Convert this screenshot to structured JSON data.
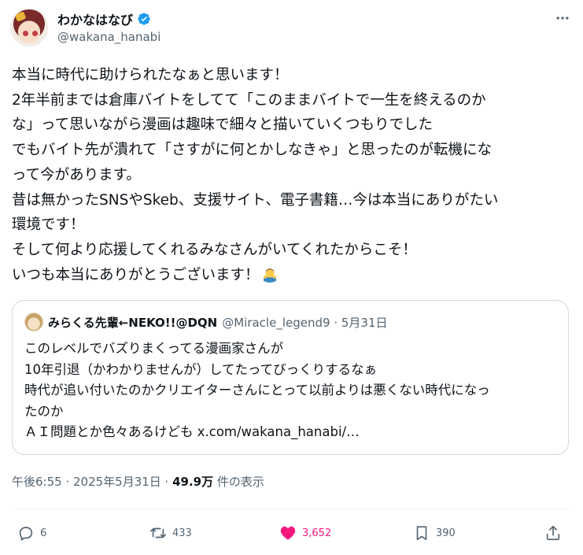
{
  "author": {
    "display_name": "わかなはなび",
    "handle": "@wakana_hanabi",
    "verified": true
  },
  "tweet": {
    "lines": [
      "本当に時代に助けられたなぁと思います！",
      "2年半前までは倉庫バイトをしてて「このままバイトで一生を終えるのか",
      "な」って思いながら漫画は趣味で細々と描いていくつもりでした",
      "でもバイト先が潰れて「さすがに何とかしなきゃ」と思ったのが転機にな",
      "って今があります。",
      "昔は無かったSNSやSkeb、支援サイト、電子書籍…今は本当にありがたい",
      "環境です！",
      "そして何より応援してくれるみなさんがいてくれたからこそ！",
      "いつも本当にありがとうございます！"
    ],
    "emoji_icon": "person-bowing-icon"
  },
  "quote": {
    "author_name": "みらくる先輩←NEKO!!@DQN",
    "handle_date": "@Miracle_legend9 · 5月31日",
    "lines": [
      "このレベルでバズりまくってる漫画家さんが",
      "10年引退（かわかりませんが）してたってびっくりするなぁ",
      "時代が追い付いたのかクリエイターさんにとって以前よりは悪くない時代になっ",
      "たのか",
      "ＡＩ問題とか色々あるけども x.com/wakana_hanabi/…"
    ]
  },
  "meta": {
    "timestamp": "午後6:55 · 2025年5月31日 · ",
    "views_count": "49.9万",
    "views_label": " 件の表示"
  },
  "actions": {
    "replies": "6",
    "retweets": "433",
    "likes": "3,652",
    "bookmarks": "390"
  },
  "colors": {
    "like": "#f91880",
    "verified": "#1d9bf0",
    "muted": "#536471"
  }
}
